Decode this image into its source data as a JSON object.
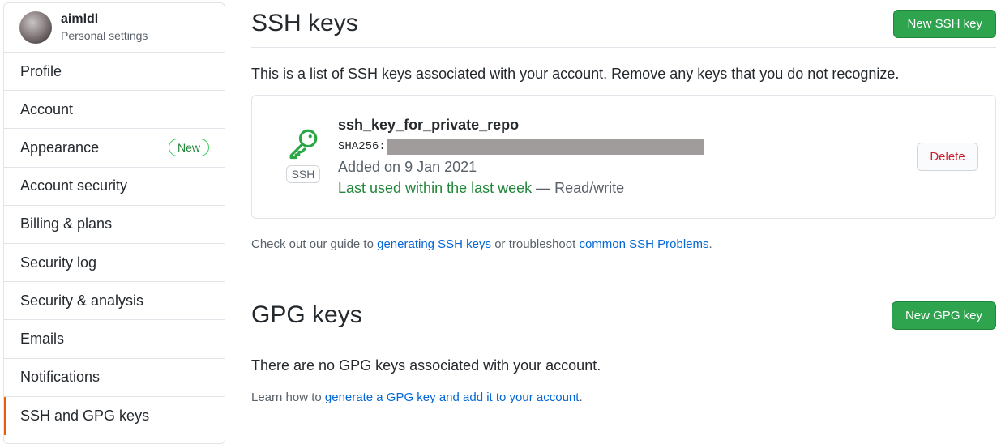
{
  "user": {
    "name": "aimldl",
    "subtitle": "Personal settings"
  },
  "sidebar": {
    "items": [
      {
        "label": "Profile"
      },
      {
        "label": "Account"
      },
      {
        "label": "Appearance",
        "badge": "New"
      },
      {
        "label": "Account security"
      },
      {
        "label": "Billing & plans"
      },
      {
        "label": "Security log"
      },
      {
        "label": "Security & analysis"
      },
      {
        "label": "Emails"
      },
      {
        "label": "Notifications"
      },
      {
        "label": "SSH and GPG keys",
        "selected": true
      }
    ]
  },
  "ssh": {
    "title": "SSH keys",
    "new_button": "New SSH key",
    "intro": "This is a list of SSH keys associated with your account. Remove any keys that you do not recognize.",
    "key": {
      "name": "ssh_key_for_private_repo",
      "fingerprint_label": "SHA256:",
      "badge": "SSH",
      "added": "Added on 9 Jan 2021",
      "last_used": "Last used within the last week",
      "access": " — Read/write",
      "delete_button": "Delete",
      "icon": "key-icon",
      "icon_color": "#28a745"
    },
    "help_prefix": "Check out our guide to ",
    "help_link1": "generating SSH keys",
    "help_middle": " or troubleshoot ",
    "help_link2": "common SSH Problems",
    "help_suffix": "."
  },
  "gpg": {
    "title": "GPG keys",
    "new_button": "New GPG key",
    "empty_text": "There are no GPG keys associated with your account.",
    "help_prefix": "Learn how to ",
    "help_link": "generate a GPG key and add it to your account",
    "help_suffix": "."
  },
  "colors": {
    "primary_button": "#2ea44f",
    "link": "#0366d6",
    "danger": "#cb2431",
    "selected_indicator": "#e36209"
  }
}
